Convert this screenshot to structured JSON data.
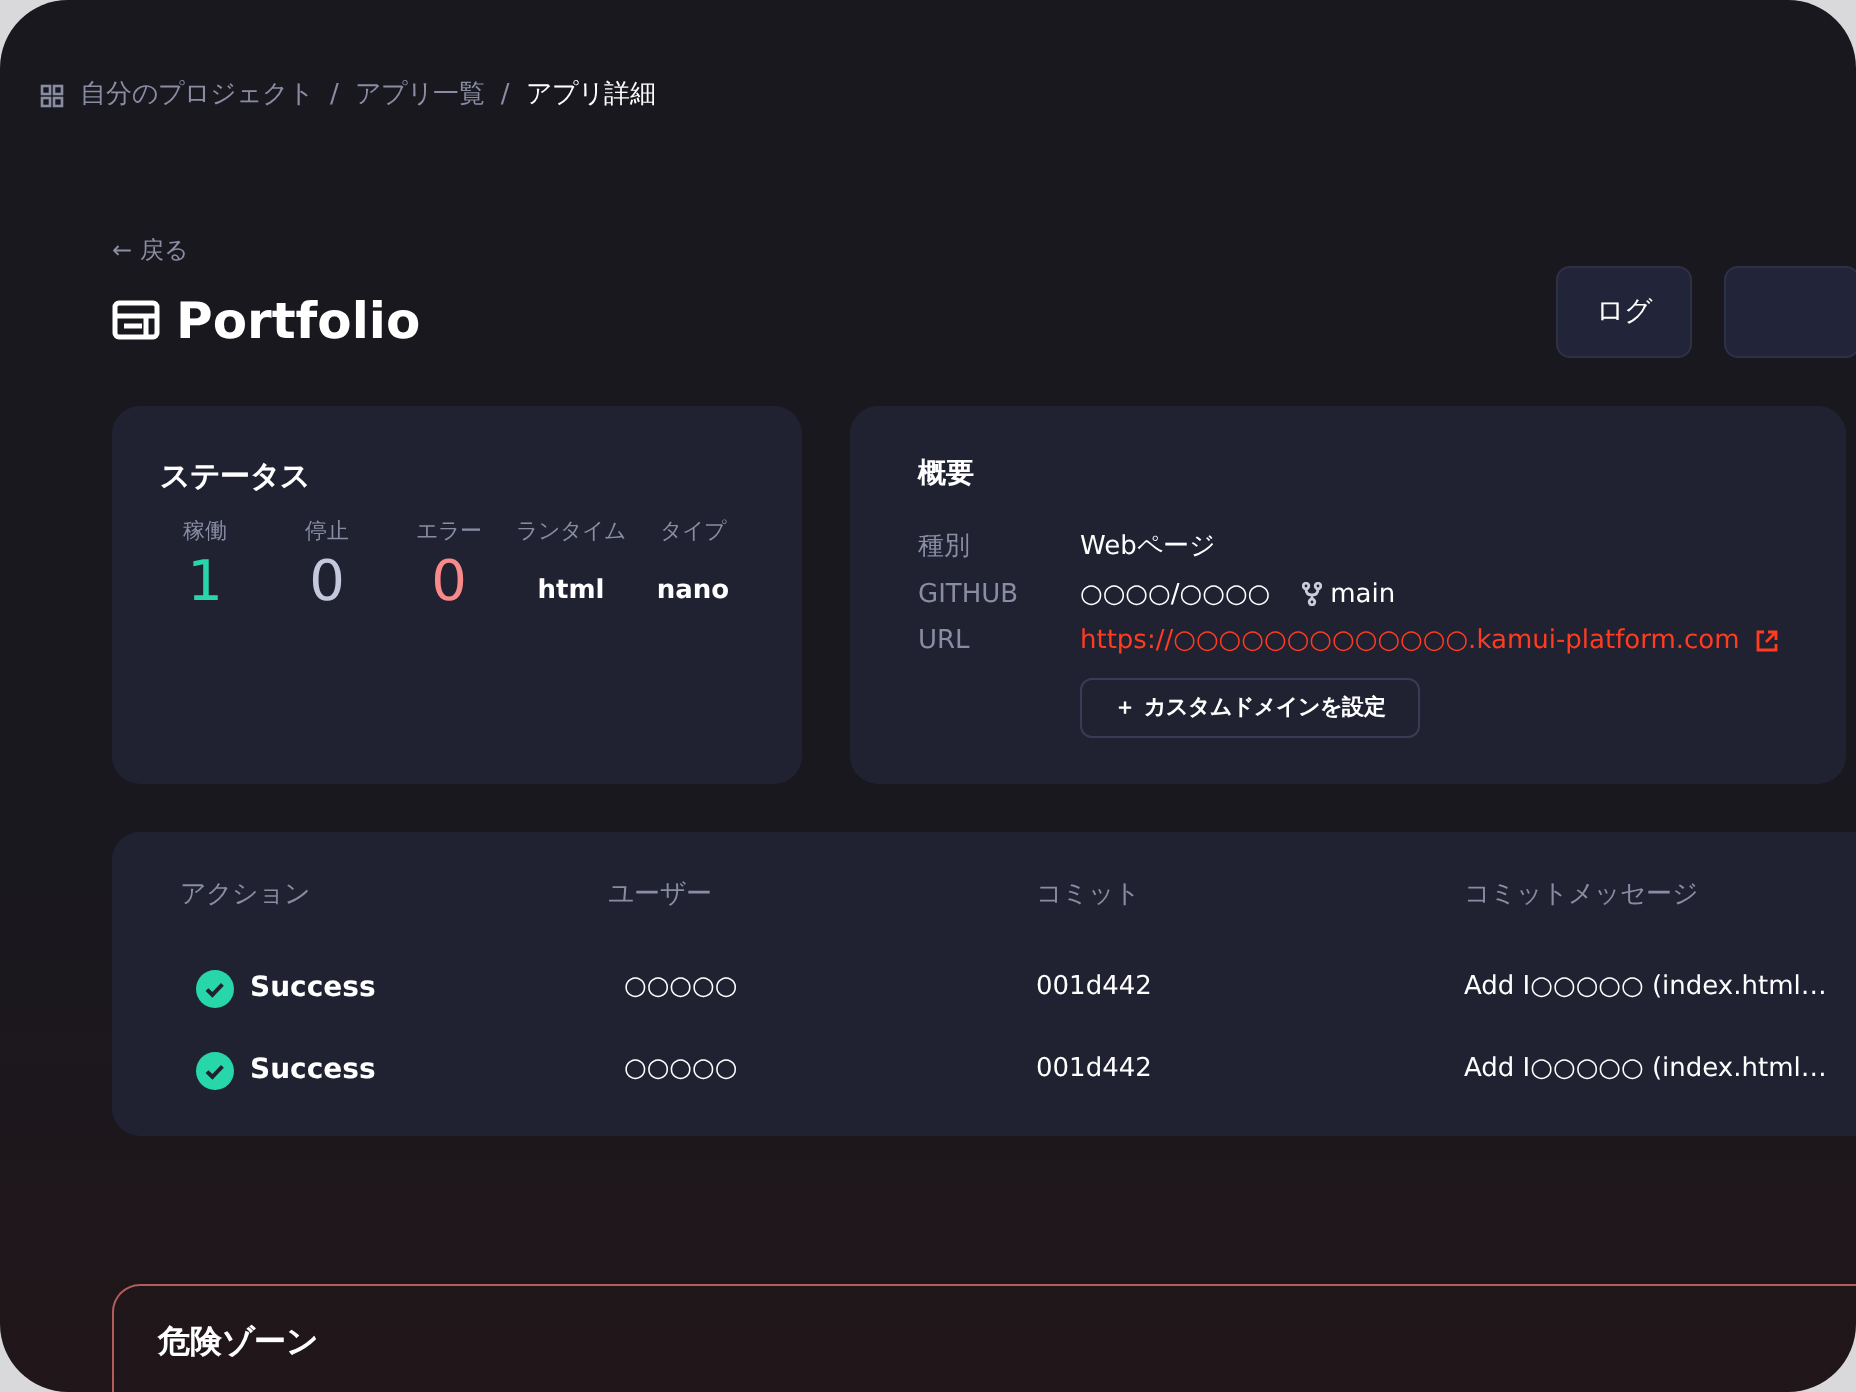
{
  "breadcrumb": [
    {
      "label": "自分のプロジェクト",
      "current": false
    },
    {
      "label": "アプリ一覧",
      "current": false
    },
    {
      "label": "アプリ詳細",
      "current": true
    }
  ],
  "breadcrumb_separator": "/",
  "back_link": "← 戻る",
  "app": {
    "title": "Portfolio"
  },
  "header_buttons": [
    {
      "label": "ログ"
    }
  ],
  "status": {
    "title": "ステータス",
    "stats": [
      {
        "label": "稼働",
        "value": "1",
        "kind": "running"
      },
      {
        "label": "停止",
        "value": "0",
        "kind": "stopped"
      },
      {
        "label": "エラー",
        "value": "0",
        "kind": "error"
      },
      {
        "label": "ランタイム",
        "value": "html",
        "kind": "text"
      },
      {
        "label": "タイプ",
        "value": "nano",
        "kind": "text"
      }
    ]
  },
  "overview": {
    "title": "概要",
    "rows": [
      {
        "label": "種別",
        "value": "Webページ",
        "kind": "text"
      },
      {
        "label": "GITHUB",
        "value": "○○○○/○○○○",
        "branch": "main",
        "kind": "repo"
      },
      {
        "label": "URL",
        "value": "https://○○○○○○○○○○○○○.kamui-platform.com",
        "kind": "link"
      }
    ],
    "domain_button": "＋ カスタムドメインを設定"
  },
  "deployments": {
    "columns": [
      "アクション",
      "ユーザー",
      "コミット",
      "コミットメッセージ"
    ],
    "rows": [
      {
        "status": "Success",
        "success": true,
        "user": "○○○○○",
        "commit": "001d442",
        "message": "Add I○○○○○ (index.html…"
      },
      {
        "status": "Success",
        "success": true,
        "user": "○○○○○",
        "commit": "001d442",
        "message": "Add I○○○○○ (index.html…"
      }
    ]
  },
  "danger_zone": {
    "title": "危険ゾーン"
  }
}
